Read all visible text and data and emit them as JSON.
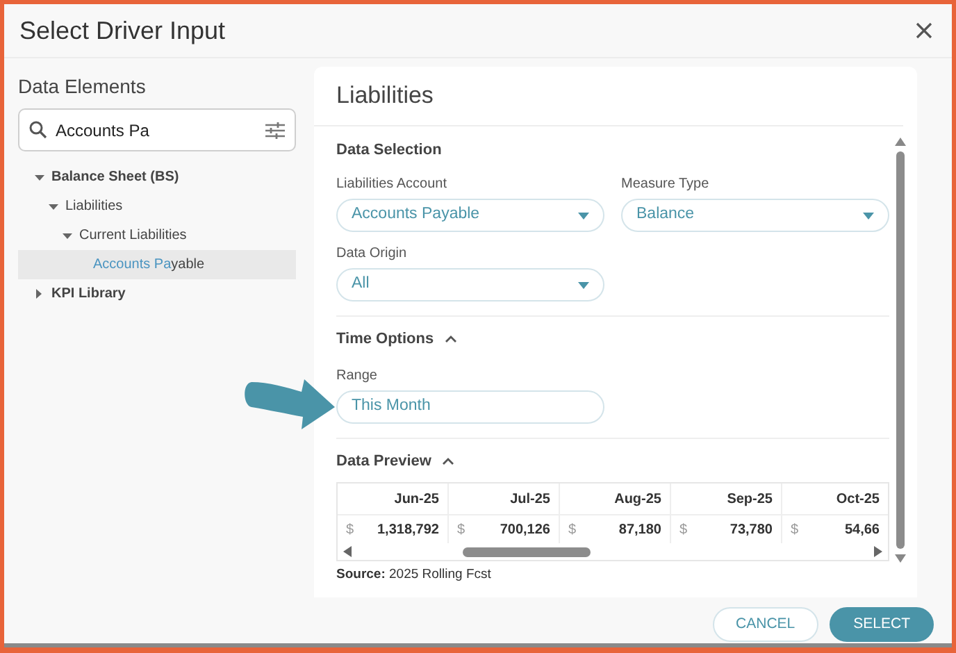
{
  "dialog": {
    "title": "Select Driver Input"
  },
  "sidebar": {
    "heading": "Data Elements",
    "search": {
      "value": "Accounts Pa"
    },
    "tree": [
      {
        "label_parts": [
          {
            "text": "Balance Sheet (BS)",
            "highlighted": false
          }
        ],
        "expanded": true,
        "selected": false,
        "children": [
          {
            "label_parts": [
              {
                "text": "Liabilities",
                "highlighted": false
              }
            ],
            "expanded": true,
            "selected": false,
            "children": [
              {
                "label_parts": [
                  {
                    "text": "Current Liabilities",
                    "highlighted": false
                  }
                ],
                "expanded": true,
                "selected": false,
                "children": [
                  {
                    "label_parts": [
                      {
                        "text": "Accounts Pa",
                        "highlighted": true
                      },
                      {
                        "text": "yable",
                        "highlighted": false
                      }
                    ],
                    "selected": true
                  }
                ]
              }
            ]
          }
        ]
      },
      {
        "label_parts": [
          {
            "text": "KPI Library",
            "highlighted": false
          }
        ],
        "expanded": false,
        "selected": false
      }
    ]
  },
  "panel": {
    "title": "Liabilities",
    "data_selection": {
      "heading": "Data Selection",
      "fields": [
        {
          "label": "Liabilities Account",
          "value": "Accounts Payable"
        },
        {
          "label": "Measure Type",
          "value": "Balance"
        },
        {
          "label": "Data Origin",
          "value": "All"
        }
      ]
    },
    "time_options": {
      "heading": "Time Options",
      "expanded": true,
      "range": {
        "label": "Range",
        "value": "This Month"
      }
    },
    "data_preview": {
      "heading": "Data Preview",
      "expanded": true,
      "table": {
        "columns": [
          "Jun-25",
          "Jul-25",
          "Aug-25",
          "Sep-25",
          "Oct-25"
        ],
        "rows": [
          {
            "cells": [
              {
                "currency": "$",
                "value": "1,318,792"
              },
              {
                "currency": "$",
                "value": "700,126"
              },
              {
                "currency": "$",
                "value": "87,180"
              },
              {
                "currency": "$",
                "value": "73,780"
              },
              {
                "currency": "$",
                "value": "54,66"
              }
            ]
          }
        ]
      },
      "source": "**Source:** 2025 Rolling Fcst"
    }
  },
  "buttons": [
    {
      "label": "CANCEL",
      "primary": false
    },
    {
      "label": "SELECT",
      "primary": true
    }
  ]
}
